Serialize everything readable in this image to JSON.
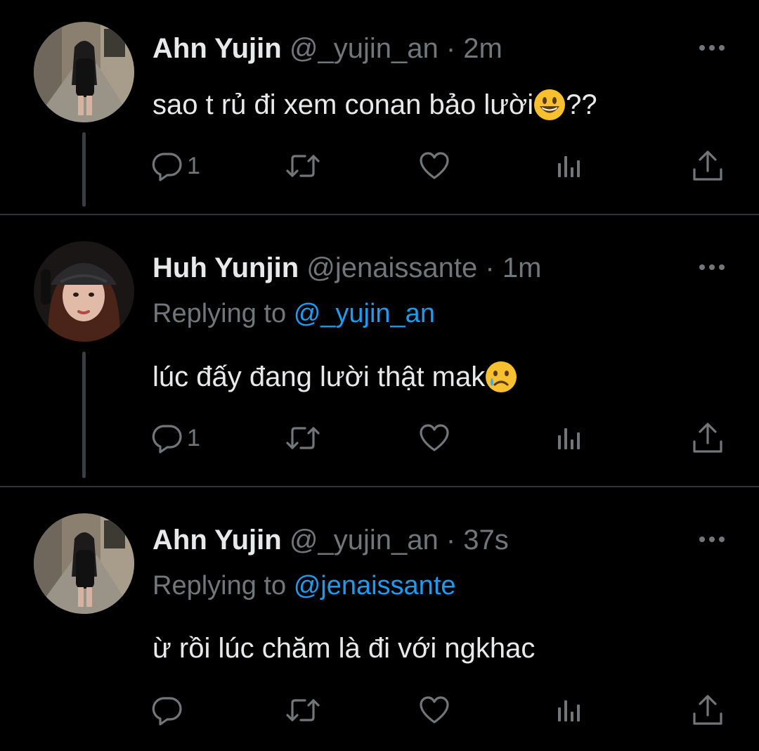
{
  "tweets": [
    {
      "name": "Ahn Yujin",
      "handle": "@_yujin_an",
      "separator": "·",
      "time": "2m",
      "replying_prefix": "",
      "replying_to": "",
      "text": "sao t rủ đi xem conan bảo lười",
      "text_suffix": "??",
      "emoji": "grinning-face-emoji",
      "reply_count": "1"
    },
    {
      "name": "Huh Yunjin",
      "handle": "@jenaissante",
      "separator": "·",
      "time": "1m",
      "replying_prefix": "Replying to",
      "replying_to": "@_yujin_an",
      "text": "lúc đấy đang lười thật mak",
      "text_suffix": "",
      "emoji": "crying-face-emoji",
      "reply_count": "1"
    },
    {
      "name": "Ahn Yujin",
      "handle": "@_yujin_an",
      "separator": "·",
      "time": "37s",
      "replying_prefix": "Replying to",
      "replying_to": "@jenaissante",
      "text": "ừ rồi lúc chăm là đi với ngkhac",
      "text_suffix": "",
      "emoji": "",
      "reply_count": ""
    }
  ],
  "icons": {
    "reply": "reply-icon",
    "retweet": "retweet-icon",
    "like": "heart-icon",
    "views": "analytics-icon",
    "share": "share-icon",
    "more": "more-icon"
  },
  "colors": {
    "background": "#000000",
    "text": "#e7e9ea",
    "secondary": "#71767b",
    "link": "#1d9bf0",
    "divider": "#2f3336"
  }
}
